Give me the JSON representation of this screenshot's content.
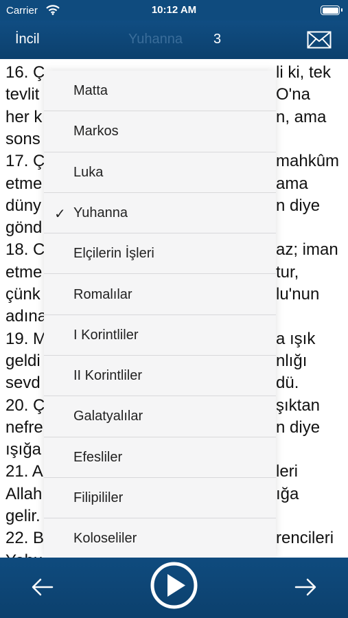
{
  "status_bar": {
    "carrier": "Carrier",
    "time": "10:12 AM"
  },
  "nav": {
    "back_label": "İncil",
    "book_title": "Yuhanna",
    "chapter": "3"
  },
  "content": {
    "lines": [
      {
        "left": "16. Ç",
        "right": "li ki, tek"
      },
      {
        "left": "tevlit",
        "right": "O'na"
      },
      {
        "left": "her k",
        "right": "n, ama"
      },
      {
        "left": "sons",
        "right": ""
      },
      {
        "left": "17. Ç",
        "right": "mahkûm"
      },
      {
        "left": "etme",
        "right": "ama"
      },
      {
        "left": "düny",
        "right": "n diye"
      },
      {
        "left": "gönd",
        "right": ""
      },
      {
        "left": "18. C",
        "right": "az; iman"
      },
      {
        "left": "etme",
        "right": "tur,"
      },
      {
        "left": "çünk",
        "right": "lu'nun"
      },
      {
        "left": "adına",
        "right": ""
      },
      {
        "left": "19. M",
        "right": "a ışık"
      },
      {
        "left": "geldi",
        "right": "nlığı"
      },
      {
        "left": "sevd",
        "right": "dü."
      },
      {
        "left": "20. Ç",
        "right": "şıktan"
      },
      {
        "left": "nefre",
        "right": "n diye"
      },
      {
        "left": "ışığa",
        "right": ""
      },
      {
        "left": "21. A",
        "right": "leri"
      },
      {
        "left": "Allah",
        "right": "ığa"
      },
      {
        "left": "gelir.",
        "right": ""
      },
      {
        "left": "22. B",
        "right": "rencileri"
      },
      {
        "left": "Yahudiye ülkesine geldiler; ve orada",
        "right": ""
      }
    ]
  },
  "dropdown": {
    "selected": "Yuhanna",
    "check_mark": "✓",
    "items": [
      "Matta",
      "Markos",
      "Luka",
      "Yuhanna",
      "Elçilerin İşleri",
      "Romalılar",
      "I Korintliler",
      "II Korintliler",
      "Galatyalılar",
      "Efesliler",
      "Filipililer",
      "Koloseliler"
    ]
  },
  "toolbar": {
    "prev_icon": "arrow-left-icon",
    "play_icon": "play-icon",
    "next_icon": "arrow-right-icon"
  },
  "colors": {
    "bar_background": "#0f4b7e",
    "nav_title_dim": "#3a6d9a",
    "dropdown_background": "#f5f5f6"
  }
}
